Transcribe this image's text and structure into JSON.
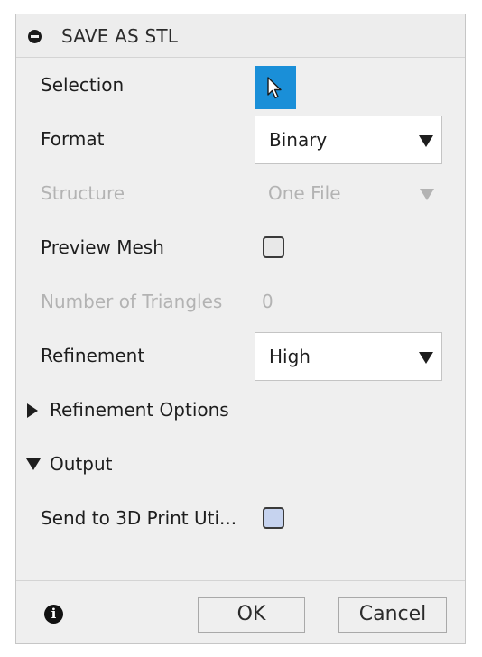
{
  "dialog": {
    "title": "SAVE AS STL"
  },
  "fields": {
    "selection_label": "Selection",
    "format_label": "Format",
    "format_value": "Binary",
    "structure_label": "Structure",
    "structure_value": "One File",
    "preview_mesh_label": "Preview Mesh",
    "preview_mesh_checked": false,
    "triangles_label": "Number of Triangles",
    "triangles_value": "0",
    "refinement_label": "Refinement",
    "refinement_value": "High"
  },
  "sections": {
    "refinement_options": "Refinement Options",
    "output": "Output"
  },
  "output": {
    "send_label": "Send to 3D Print Uti...",
    "send_checked": false
  },
  "buttons": {
    "ok": "OK",
    "cancel": "Cancel"
  },
  "icons": {
    "collapse": "collapse-icon",
    "selection": "cursor-arrow-icon",
    "info": "info-icon"
  },
  "colors": {
    "accent": "#1a8fd8"
  }
}
